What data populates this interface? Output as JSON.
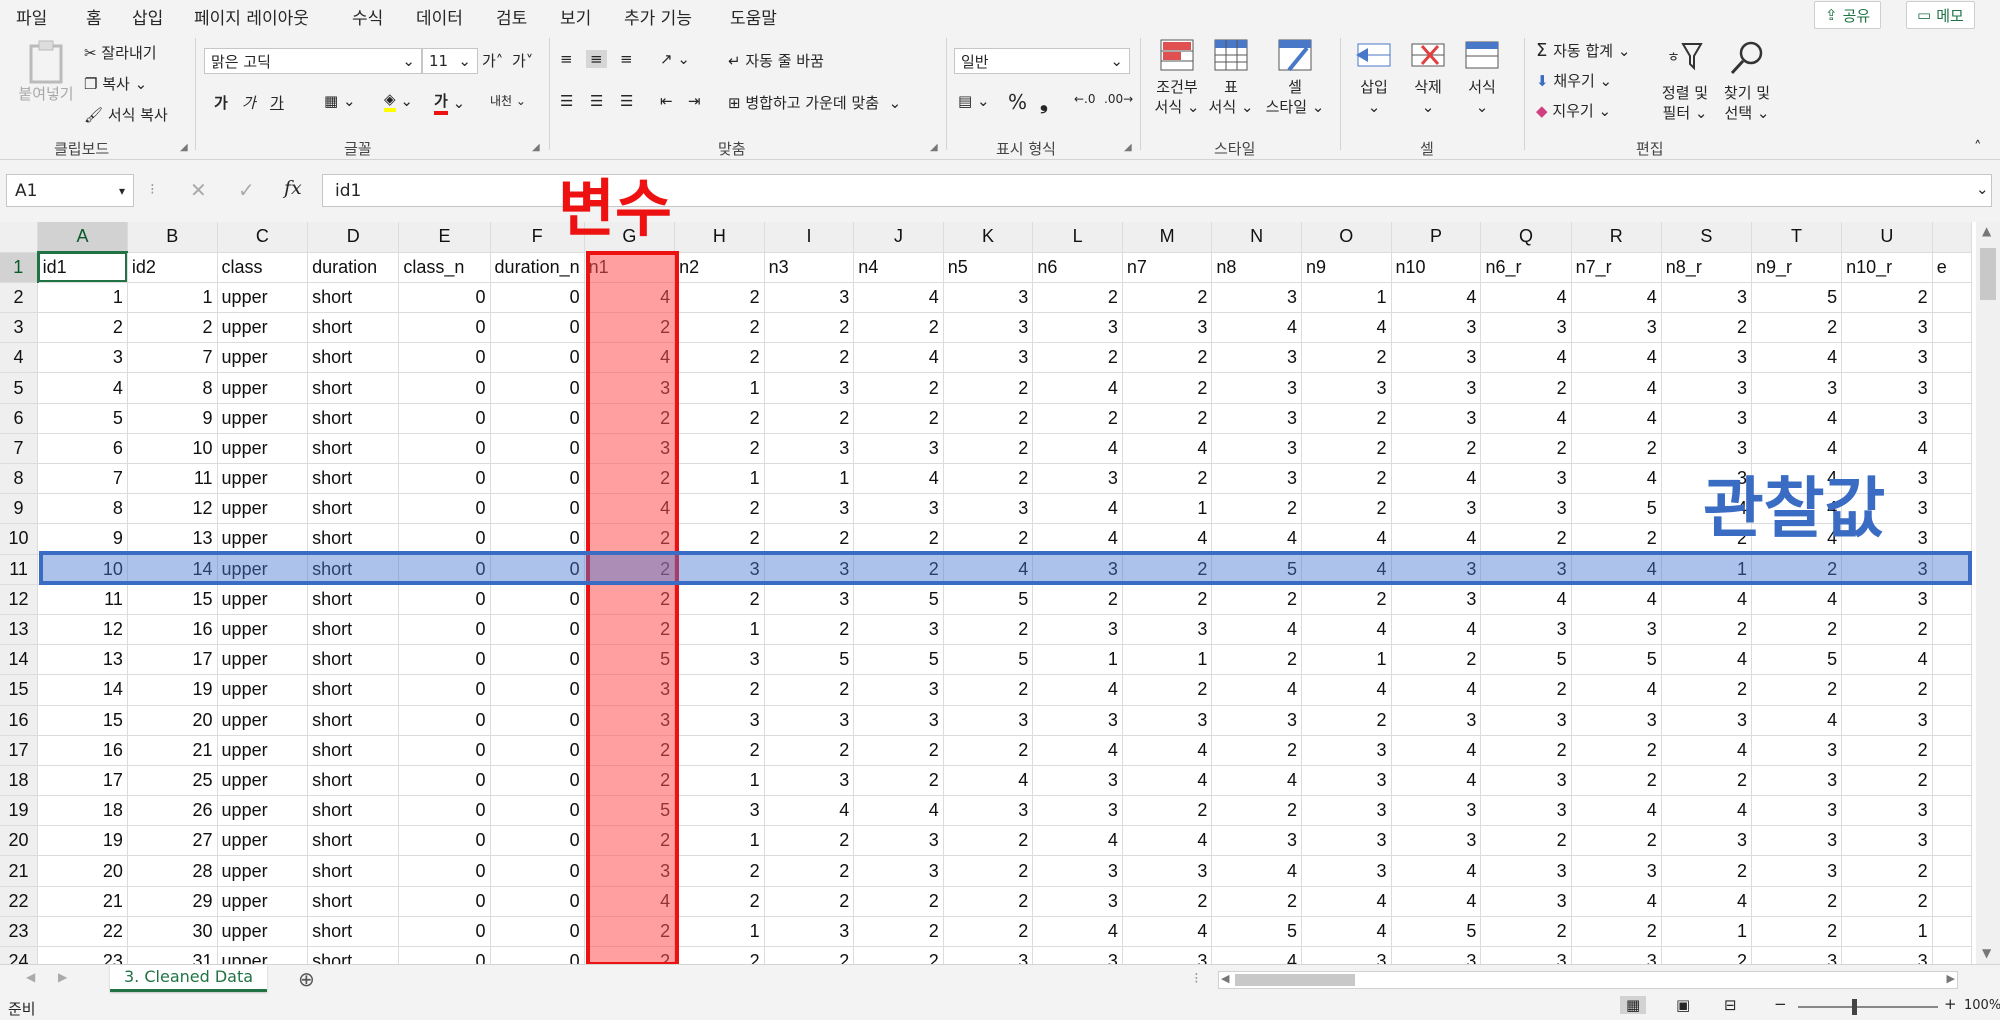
{
  "menu": {
    "items": [
      "파일",
      "홈",
      "삽입",
      "페이지 레이아웃",
      "수식",
      "데이터",
      "검토",
      "보기",
      "추가 기능",
      "도움말"
    ],
    "active_index": 1,
    "share_label": "공유",
    "notes_label": "메모"
  },
  "ribbon": {
    "clipboard": {
      "paste": "붙여넣기",
      "cut": "잘라내기",
      "copy": "복사",
      "format_painter": "서식 복사",
      "group": "클립보드"
    },
    "font": {
      "name": "맑은 고딕",
      "size": "11",
      "bold": "가",
      "italic": "가",
      "underline": "가",
      "group": "글꼴"
    },
    "alignment": {
      "wrap_text": "자동 줄 바꿈",
      "merge_center": "병합하고 가운데 맞춤",
      "group": "맞춤"
    },
    "number": {
      "format": "일반",
      "group": "표시 형식"
    },
    "styles": {
      "conditional_l1": "조건부",
      "conditional_l2": "서식",
      "table_l1": "표",
      "table_l2": "서식",
      "cell_styles_l1": "셀",
      "cell_styles_l2": "스타일",
      "group": "스타일"
    },
    "cells": {
      "insert": "삽입",
      "delete": "삭제",
      "format": "서식",
      "group": "셀"
    },
    "editing": {
      "autosum": "자동 합계",
      "fill": "채우기",
      "clear": "지우기",
      "sort_l1": "정렬 및",
      "sort_l2": "필터",
      "find_l1": "찾기 및",
      "find_l2": "선택",
      "group": "편집"
    }
  },
  "formula_bar": {
    "name_box": "A1",
    "content": "id1"
  },
  "grid": {
    "columns": [
      "A",
      "B",
      "C",
      "D",
      "E",
      "F",
      "G",
      "H",
      "I",
      "J",
      "K",
      "L",
      "M",
      "N",
      "O",
      "P",
      "Q",
      "R",
      "S",
      "T",
      "U"
    ],
    "selected_column_index": 0,
    "headers": [
      "id1",
      "id2",
      "class",
      "duration",
      "class_n",
      "duration_n",
      "n1",
      "n2",
      "n3",
      "n4",
      "n5",
      "n6",
      "n7",
      "n8",
      "n9",
      "n10",
      "n6_r",
      "n7_r",
      "n8_r",
      "n9_r",
      "n10_r"
    ],
    "rows": [
      [
        1,
        1,
        "upper",
        "short",
        0,
        0,
        4,
        2,
        3,
        4,
        3,
        2,
        2,
        3,
        1,
        4,
        4,
        4,
        3,
        5,
        2
      ],
      [
        2,
        2,
        "upper",
        "short",
        0,
        0,
        2,
        2,
        2,
        2,
        3,
        3,
        3,
        4,
        4,
        3,
        3,
        3,
        2,
        2,
        3
      ],
      [
        3,
        7,
        "upper",
        "short",
        0,
        0,
        4,
        2,
        2,
        4,
        3,
        2,
        2,
        3,
        2,
        3,
        4,
        4,
        3,
        4,
        3
      ],
      [
        4,
        8,
        "upper",
        "short",
        0,
        0,
        3,
        1,
        3,
        2,
        2,
        4,
        2,
        3,
        3,
        3,
        2,
        4,
        3,
        3,
        3
      ],
      [
        5,
        9,
        "upper",
        "short",
        0,
        0,
        2,
        2,
        2,
        2,
        2,
        2,
        2,
        3,
        2,
        3,
        4,
        4,
        3,
        4,
        3
      ],
      [
        6,
        10,
        "upper",
        "short",
        0,
        0,
        3,
        2,
        3,
        3,
        2,
        4,
        4,
        3,
        2,
        2,
        2,
        2,
        3,
        4,
        4
      ],
      [
        7,
        11,
        "upper",
        "short",
        0,
        0,
        2,
        1,
        1,
        4,
        2,
        3,
        2,
        3,
        2,
        4,
        3,
        4,
        3,
        4,
        3
      ],
      [
        8,
        12,
        "upper",
        "short",
        0,
        0,
        4,
        2,
        3,
        3,
        3,
        4,
        1,
        2,
        2,
        3,
        3,
        5,
        4,
        4,
        3
      ],
      [
        9,
        13,
        "upper",
        "short",
        0,
        0,
        2,
        2,
        2,
        2,
        2,
        4,
        4,
        4,
        4,
        4,
        2,
        2,
        2,
        4,
        3
      ],
      [
        10,
        14,
        "upper",
        "short",
        0,
        0,
        2,
        3,
        3,
        2,
        4,
        3,
        2,
        5,
        4,
        3,
        3,
        4,
        1,
        2,
        3
      ],
      [
        11,
        15,
        "upper",
        "short",
        0,
        0,
        2,
        2,
        3,
        5,
        5,
        2,
        2,
        2,
        2,
        3,
        4,
        4,
        4,
        4,
        3
      ],
      [
        12,
        16,
        "upper",
        "short",
        0,
        0,
        2,
        1,
        2,
        3,
        2,
        3,
        3,
        4,
        4,
        4,
        3,
        3,
        2,
        2,
        2
      ],
      [
        13,
        17,
        "upper",
        "short",
        0,
        0,
        5,
        3,
        5,
        5,
        5,
        1,
        1,
        2,
        1,
        2,
        5,
        5,
        4,
        5,
        4
      ],
      [
        14,
        19,
        "upper",
        "short",
        0,
        0,
        3,
        2,
        2,
        3,
        2,
        4,
        2,
        4,
        4,
        4,
        2,
        4,
        2,
        2,
        2
      ],
      [
        15,
        20,
        "upper",
        "short",
        0,
        0,
        3,
        3,
        3,
        3,
        3,
        3,
        3,
        3,
        2,
        3,
        3,
        3,
        3,
        4,
        3
      ],
      [
        16,
        21,
        "upper",
        "short",
        0,
        0,
        2,
        2,
        2,
        2,
        2,
        4,
        4,
        2,
        3,
        4,
        2,
        2,
        4,
        3,
        2
      ],
      [
        17,
        25,
        "upper",
        "short",
        0,
        0,
        2,
        1,
        3,
        2,
        4,
        3,
        4,
        4,
        3,
        4,
        3,
        2,
        2,
        3,
        2
      ],
      [
        18,
        26,
        "upper",
        "short",
        0,
        0,
        5,
        3,
        4,
        4,
        3,
        3,
        2,
        2,
        3,
        3,
        3,
        4,
        4,
        3,
        3
      ],
      [
        19,
        27,
        "upper",
        "short",
        0,
        0,
        2,
        1,
        2,
        3,
        2,
        4,
        4,
        3,
        3,
        3,
        2,
        2,
        3,
        3,
        3
      ],
      [
        20,
        28,
        "upper",
        "short",
        0,
        0,
        3,
        2,
        2,
        3,
        2,
        3,
        3,
        4,
        3,
        4,
        3,
        3,
        2,
        3,
        2
      ],
      [
        21,
        29,
        "upper",
        "short",
        0,
        0,
        4,
        2,
        2,
        2,
        2,
        3,
        2,
        2,
        4,
        4,
        3,
        4,
        4,
        2,
        2
      ],
      [
        22,
        30,
        "upper",
        "short",
        0,
        0,
        2,
        1,
        3,
        2,
        2,
        4,
        4,
        5,
        4,
        5,
        2,
        2,
        1,
        2,
        1
      ],
      [
        23,
        31,
        "upper",
        "short",
        0,
        0,
        2,
        2,
        2,
        2,
        3,
        3,
        3,
        4,
        3,
        3,
        3,
        3,
        2,
        3,
        3
      ]
    ],
    "partial_header_next": "e"
  },
  "annotations": {
    "variable": "변수",
    "observation": "관찰값"
  },
  "sheet_tabs": [
    "3. Cleaned Data"
  ],
  "status": {
    "ready": "준비",
    "zoom": "100%"
  },
  "colors": {
    "accent": "#217346",
    "variable_highlight": "#ee1111",
    "observation_highlight": "#3a6cc4"
  }
}
